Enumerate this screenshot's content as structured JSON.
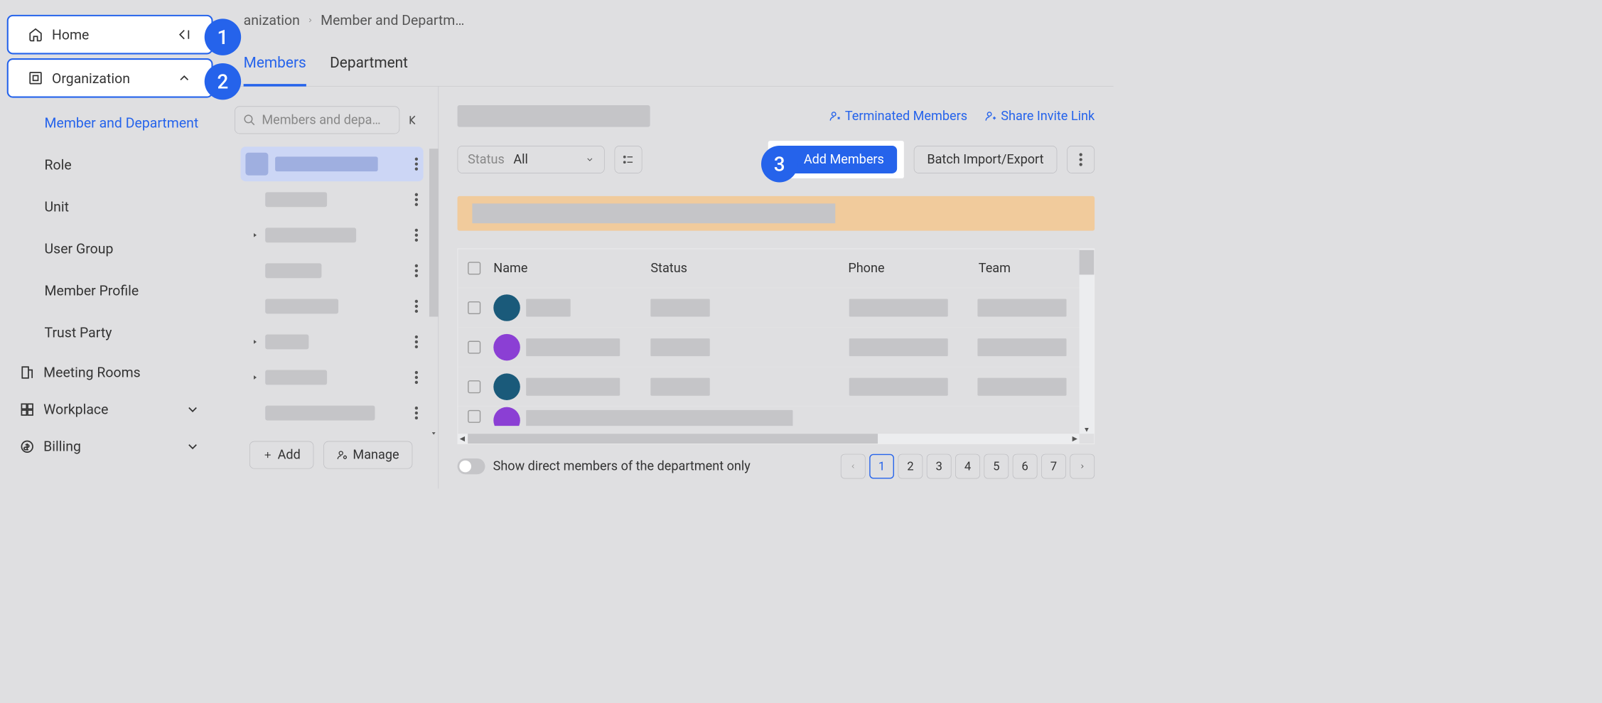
{
  "badges": {
    "b1": "1",
    "b2": "2",
    "b3": "3"
  },
  "sidebar": {
    "home": "Home",
    "organization": "Organization",
    "sub": {
      "member_dept": "Member and Department",
      "role": "Role",
      "unit": "Unit",
      "user_group": "User Group",
      "member_profile": "Member Profile",
      "trust_party": "Trust Party"
    },
    "meeting_rooms": "Meeting Rooms",
    "workplace": "Workplace",
    "billing": "Billing"
  },
  "breadcrumb": {
    "item1": "anization",
    "item2": "Member and Departm…"
  },
  "tabs": {
    "members": "Members",
    "department": "Department"
  },
  "dept": {
    "search_placeholder": "Members and depa…",
    "add": "Add",
    "manage": "Manage"
  },
  "members": {
    "terminated": "Terminated Members",
    "share": "Share Invite Link",
    "status_label": "Status",
    "status_value": "All",
    "add_members": "Add Members",
    "batch": "Batch Import/Export",
    "columns": {
      "name": "Name",
      "status": "Status",
      "phone": "Phone",
      "team": "Team"
    },
    "toggle_note": "Show direct members of the department only",
    "pages": [
      "1",
      "2",
      "3",
      "4",
      "5",
      "6",
      "7"
    ]
  }
}
